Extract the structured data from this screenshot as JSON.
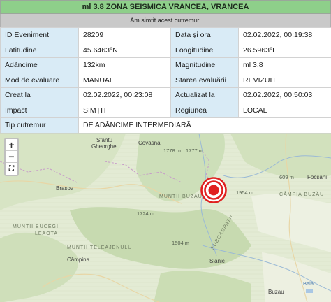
{
  "header": {
    "title": "ml 3.8 ZONA SEISMICA VRANCEA, VRANCEA",
    "subtitle": "Am simtit acest cutremur!"
  },
  "info_rows": [
    [
      {
        "label": "ID Eveniment",
        "value": "28209"
      },
      {
        "label": "Data și ora",
        "value": "02.02.2022, 00:19:38"
      }
    ],
    [
      {
        "label": "Latitudine",
        "value": "45.6463°N"
      },
      {
        "label": "Longitudine",
        "value": "26.5963°E"
      }
    ],
    [
      {
        "label": "Adâncime",
        "value": "132km"
      },
      {
        "label": "Magnitudine",
        "value": "ml 3.8"
      }
    ],
    [
      {
        "label": "Mod de evaluare",
        "value": "MANUAL"
      },
      {
        "label": "Starea evaluării",
        "value": "REVIZUIT"
      }
    ],
    [
      {
        "label": "Creat la",
        "value": "02.02.2022, 00:23:08"
      },
      {
        "label": "Actualizat la",
        "value": "02.02.2022, 00:50:03"
      }
    ],
    [
      {
        "label": "Impact",
        "value": "SIMȚIT"
      },
      {
        "label": "Regiunea",
        "value": "LOCAL"
      }
    ]
  ],
  "tip": {
    "label": "Tip cutremur",
    "value": "DE ADÂNCIME INTERMEDIARĂ"
  },
  "map": {
    "zoom_in": "+",
    "zoom_out": "−",
    "fullscreen": "⛶",
    "marker_color": "#e02020",
    "labels": {
      "covasna": "Covasna",
      "sfantu": "Sfântu",
      "gheorghe": "Gheorghe",
      "elev1": "1778 m",
      "elev2": "1777 m",
      "brasov": "Brasov",
      "focsani": "Focsani",
      "elev3": "609 m",
      "campia": "CÂMPIA BUZĂU",
      "muntii_buzaului": "MUNTII BUZAULUI",
      "bucegi": "MUNTII BUCEGI",
      "leaota": "LEAOTA",
      "teleajen": "MUNTII TELEAJENULUI",
      "campina": "Câmpina",
      "buzau": "Buzau",
      "elev4": "1954 m",
      "elev5": "1724 m",
      "elev6": "1504 m",
      "slanic": "Slanic",
      "vrancea_sus": "SUBCARPATII",
      "bala": "Bala"
    }
  }
}
